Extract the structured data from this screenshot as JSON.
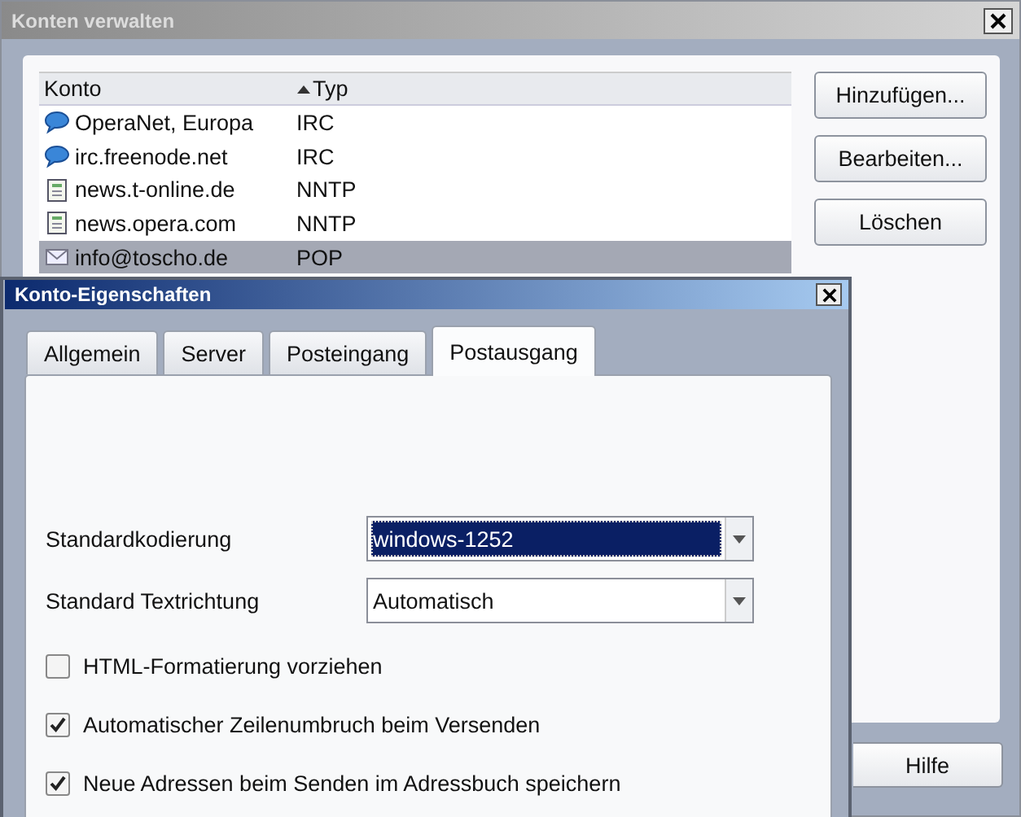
{
  "back_window": {
    "title": "Konten verwalten",
    "columns": [
      {
        "label": "Konto",
        "sorted": false
      },
      {
        "label": "Typ",
        "sorted": true
      }
    ],
    "accounts": [
      {
        "name": "OperaNet, Europa",
        "type": "IRC",
        "kind": "chat",
        "selected": false
      },
      {
        "name": "irc.freenode.net",
        "type": "IRC",
        "kind": "chat",
        "selected": false
      },
      {
        "name": "news.t-online.de",
        "type": "NNTP",
        "kind": "news",
        "selected": false
      },
      {
        "name": "news.opera.com",
        "type": "NNTP",
        "kind": "news",
        "selected": false
      },
      {
        "name": "info@toscho.de",
        "type": "POP",
        "kind": "mail",
        "selected": true
      }
    ],
    "buttons": [
      "Hinzufügen...",
      "Bearbeiten...",
      "Löschen"
    ],
    "help_button": "Hilfe"
  },
  "front_window": {
    "title": "Konto-Eigenschaften",
    "tabs": [
      {
        "label": "Allgemein",
        "selected": false
      },
      {
        "label": "Server",
        "selected": false
      },
      {
        "label": "Posteingang",
        "selected": false
      },
      {
        "label": "Postausgang",
        "selected": true
      }
    ],
    "selects": [
      {
        "label": "Standardkodierung",
        "value": "windows-1252",
        "focused": true
      },
      {
        "label": "Standard Textrichtung",
        "value": "Automatisch",
        "focused": false
      }
    ],
    "checkboxes": [
      {
        "label": "HTML-Formatierung vorziehen",
        "checked": false
      },
      {
        "label": "Automatischer Zeilenumbruch beim Versenden",
        "checked": true
      },
      {
        "label": "Neue Adressen beim Senden im Adressbuch speichern",
        "checked": true
      }
    ]
  }
}
